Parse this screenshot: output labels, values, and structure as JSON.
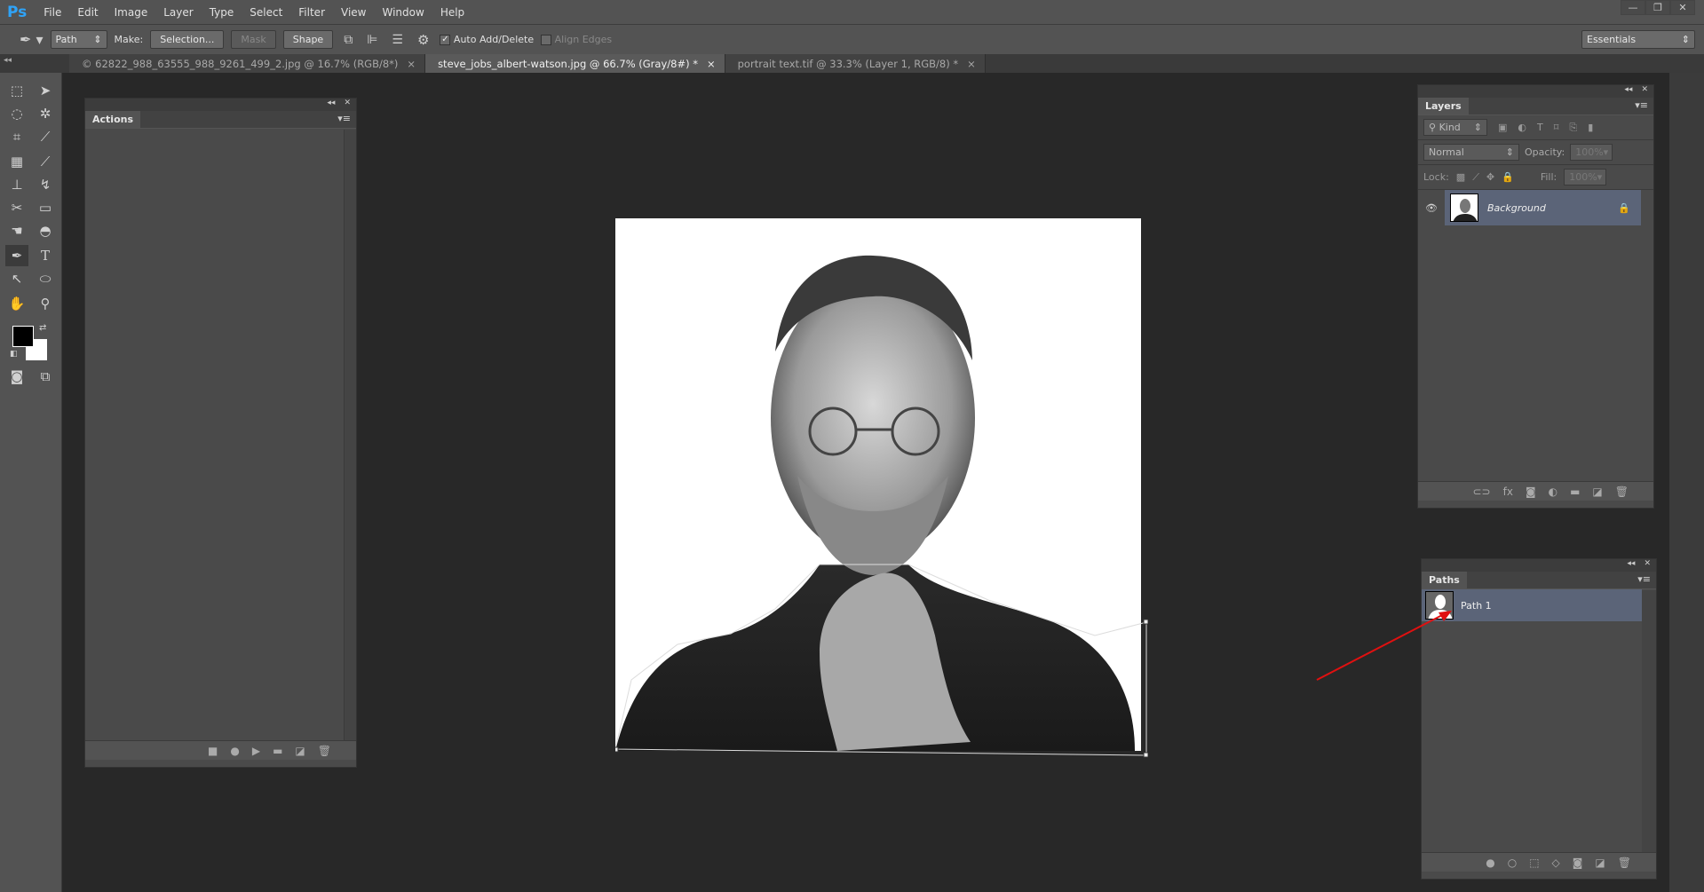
{
  "app": {
    "logo": "Ps"
  },
  "menu": [
    "File",
    "Edit",
    "Image",
    "Layer",
    "Type",
    "Select",
    "Filter",
    "View",
    "Window",
    "Help"
  ],
  "window_controls": {
    "minimize": "—",
    "restore": "❐",
    "close": "✕"
  },
  "options_bar": {
    "mode": "Path",
    "make_label": "Make:",
    "selection_button": "Selection...",
    "mask_button": "Mask",
    "shape_button": "Shape",
    "auto_add_delete": {
      "label": "Auto Add/Delete",
      "checked": true
    },
    "align_edges": {
      "label": "Align Edges",
      "checked": false
    },
    "workspace": "Essentials"
  },
  "tabs": [
    {
      "label": "© 62822_988_63555_988_9261_499_2.jpg @ 16.7% (RGB/8*)",
      "active": false
    },
    {
      "label": "steve_jobs_albert-watson.jpg @ 66.7% (Gray/8#) *",
      "active": true
    },
    {
      "label": "portrait text.tif @ 33.3% (Layer 1, RGB/8) *",
      "active": false
    }
  ],
  "actions_panel": {
    "title": "Actions",
    "footer_icons": [
      "stop-icon",
      "record-icon",
      "play-icon",
      "folder-icon",
      "new-icon",
      "trash-icon"
    ]
  },
  "layers_panel": {
    "title": "Layers",
    "filter": "Kind",
    "blend_mode": "Normal",
    "opacity_label": "Opacity:",
    "opacity": "100%",
    "lock_label": "Lock:",
    "fill_label": "Fill:",
    "fill": "100%",
    "layers": [
      {
        "name": "Background",
        "visible": true,
        "locked": true
      }
    ]
  },
  "paths_panel": {
    "title": "Paths",
    "paths": [
      {
        "name": "Path 1",
        "selected": true
      }
    ]
  },
  "colors": {
    "accent_selected": "#5b6478",
    "annotation_arrow": "#e01010",
    "foreground": "#000000",
    "background": "#ffffff"
  }
}
